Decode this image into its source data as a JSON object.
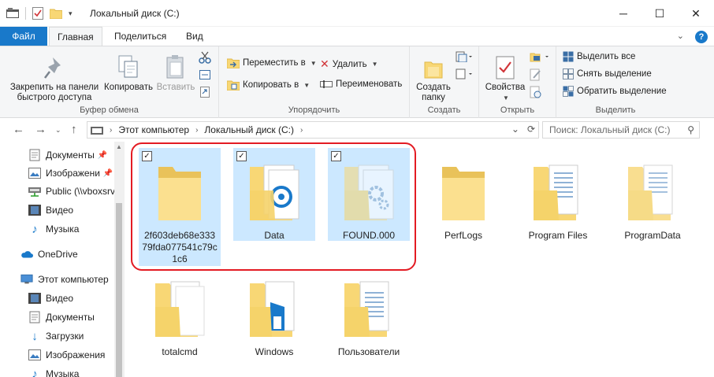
{
  "window": {
    "title": "Локальный диск (C:)",
    "minimize": "─",
    "maximize": "☐",
    "close": "✕"
  },
  "tabs": {
    "file": "Файл",
    "home": "Главная",
    "share": "Поделиться",
    "view": "Вид",
    "collapse": "⌄",
    "help": "?"
  },
  "ribbon": {
    "clipboard": {
      "label": "Буфер обмена",
      "pin": "Закрепить на панели быстрого доступа",
      "copy": "Копировать",
      "paste": "Вставить"
    },
    "organize": {
      "label": "Упорядочить",
      "move": "Переместить в",
      "copy_to": "Копировать в",
      "delete": "Удалить",
      "rename": "Переименовать"
    },
    "new": {
      "label": "Создать",
      "new_folder": "Создать папку"
    },
    "open": {
      "label": "Открыть",
      "properties": "Свойства"
    },
    "select": {
      "label": "Выделить",
      "select_all": "Выделить все",
      "select_none": "Снять выделение",
      "invert": "Обратить выделение"
    }
  },
  "nav": {
    "back": "←",
    "forward": "→",
    "up": "↑",
    "crumbs": [
      "Этот компьютер",
      "Локальный диск (C:)"
    ],
    "search_placeholder": "Поиск: Локальный диск (C:)",
    "refresh": "⟳",
    "dropdown": "⌄"
  },
  "navpane": {
    "items": [
      {
        "label": "Документы",
        "icon": "documents-icon",
        "pinned": true
      },
      {
        "label": "Изображени",
        "icon": "pictures-icon",
        "pinned": true
      },
      {
        "label": "Public (\\\\vboxsrv",
        "icon": "network-drive-icon",
        "pinned": false
      },
      {
        "label": "Видео",
        "icon": "video-icon",
        "pinned": false
      },
      {
        "label": "Музыка",
        "icon": "music-icon",
        "pinned": false
      },
      {
        "label": "OneDrive",
        "icon": "onedrive-icon",
        "pinned": false
      },
      {
        "label": "Этот компьютер",
        "icon": "computer-icon",
        "pinned": false
      },
      {
        "label": "Видео",
        "icon": "video-icon",
        "pinned": false
      },
      {
        "label": "Документы",
        "icon": "documents-icon",
        "pinned": false
      },
      {
        "label": "Загрузки",
        "icon": "downloads-icon",
        "pinned": false
      },
      {
        "label": "Изображения",
        "icon": "pictures-icon",
        "pinned": false
      },
      {
        "label": "Музыка",
        "icon": "music-icon",
        "pinned": false
      }
    ]
  },
  "files": [
    {
      "name": "2f603deb68e33379fda077541c79c1c6",
      "selected": true,
      "kind": "empty"
    },
    {
      "name": "Data",
      "selected": true,
      "kind": "blue-doc"
    },
    {
      "name": "FOUND.000",
      "selected": true,
      "kind": "gear-doc"
    },
    {
      "name": "PerfLogs",
      "selected": false,
      "kind": "empty"
    },
    {
      "name": "Program Files",
      "selected": false,
      "kind": "lined-doc"
    },
    {
      "name": "ProgramData",
      "selected": false,
      "kind": "lined-doc"
    },
    {
      "name": "totalcmd",
      "selected": false,
      "kind": "paper-doc"
    },
    {
      "name": "Windows",
      "selected": false,
      "kind": "win-doc"
    },
    {
      "name": "Пользователи",
      "selected": false,
      "kind": "lined-doc"
    }
  ],
  "colors": {
    "accent": "#1979ca",
    "selection": "#cce8ff",
    "highlight_ring": "#e31b23",
    "folder": "#f8d775"
  }
}
